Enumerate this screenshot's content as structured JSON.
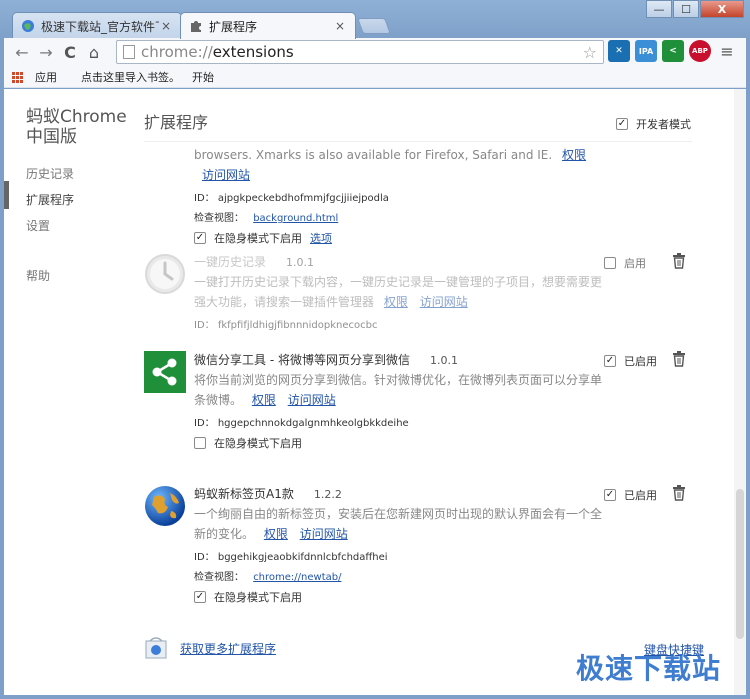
{
  "tabs": [
    {
      "title": "极速下载站_官方软件下载",
      "close": "×"
    },
    {
      "title": "扩展程序",
      "close": "×"
    }
  ],
  "window_controls": {
    "minimize": "—",
    "maximize": "☐",
    "close": "X"
  },
  "toolbar": {
    "back": "←",
    "forward": "→",
    "reload": "C",
    "home": "⌂",
    "url_scheme": "chrome://",
    "url_host": "extensions",
    "star": "☆",
    "menu": "≡"
  },
  "toolbar_extensions": [
    {
      "name": "xmarks-icon",
      "label": "✕",
      "color": "#1a6fb3"
    },
    {
      "name": "ipa-icon",
      "label": "IPA",
      "color": "#3a8fd6"
    },
    {
      "name": "share-icon",
      "label": "<",
      "color": "#1f8f3a"
    },
    {
      "name": "abp-icon",
      "label": "ABP",
      "color": "#c8102e"
    }
  ],
  "bookmarks": {
    "apps": "应用",
    "import": "点击这里导入书签。",
    "start": "开始"
  },
  "sidebar": {
    "title": "蚂蚁Chrome中国版",
    "items": [
      {
        "label": "历史记录"
      },
      {
        "label": "扩展程序"
      },
      {
        "label": "设置"
      },
      {
        "label": "帮助"
      }
    ]
  },
  "main": {
    "title": "扩展程序",
    "developer_mode": "开发者模式"
  },
  "extensions": [
    {
      "desc": "browsers. Xmarks is also available for Firefox, Safari and IE.",
      "permissions": "权限",
      "website": "访问网站",
      "id_label": "ID：",
      "id": "ajpgkpeckebdhofmmjfgcjjiiejpodla",
      "inspect_label": "检查视图：",
      "inspect_link": "background.html",
      "incognito": "在隐身模式下启用",
      "options": "选项"
    },
    {
      "name": "一键历史记录",
      "version": "1.0.1",
      "desc": "一键打开历史记录下载内容，一键历史记录是一键管理的子项目，想要需要更强大功能，请搜索一键插件管理器",
      "permissions": "权限",
      "website": "访问网站",
      "id_label": "ID：",
      "id": "fkfpfifjldhigjfibnnnidopknecocbc",
      "enabled_label": "启用",
      "enabled": false
    },
    {
      "name": "微信分享工具 - 将微博等网页分享到微信",
      "version": "1.0.1",
      "desc": "将你当前浏览的网页分享到微信。针对微博优化，在微博列表页面可以分享单条微博。",
      "permissions": "权限",
      "website": "访问网站",
      "id_label": "ID：",
      "id": "hggepchnnokdgalgnmhkeolgbkkdeihe",
      "incognito": "在隐身模式下启用",
      "enabled_label": "已启用",
      "enabled": true
    },
    {
      "name": "蚂蚁新标签页A1款",
      "version": "1.2.2",
      "desc": "一个绚丽自由的新标签页，安装后在您新建网页时出现的默认界面会有一个全新的变化。",
      "permissions": "权限",
      "website": "访问网站",
      "id_label": "ID：",
      "id": "bggehikgjeaobkifdnnlcbfchdaffhei",
      "inspect_label": "检查视图：",
      "inspect_link": "chrome://newtab/",
      "incognito": "在隐身模式下启用",
      "enabled_label": "已启用",
      "enabled": true
    }
  ],
  "footer": {
    "get_more": "获取更多扩展程序",
    "shortcuts": "键盘快捷键"
  },
  "watermark": "极速下载站",
  "checkmark": "✓"
}
